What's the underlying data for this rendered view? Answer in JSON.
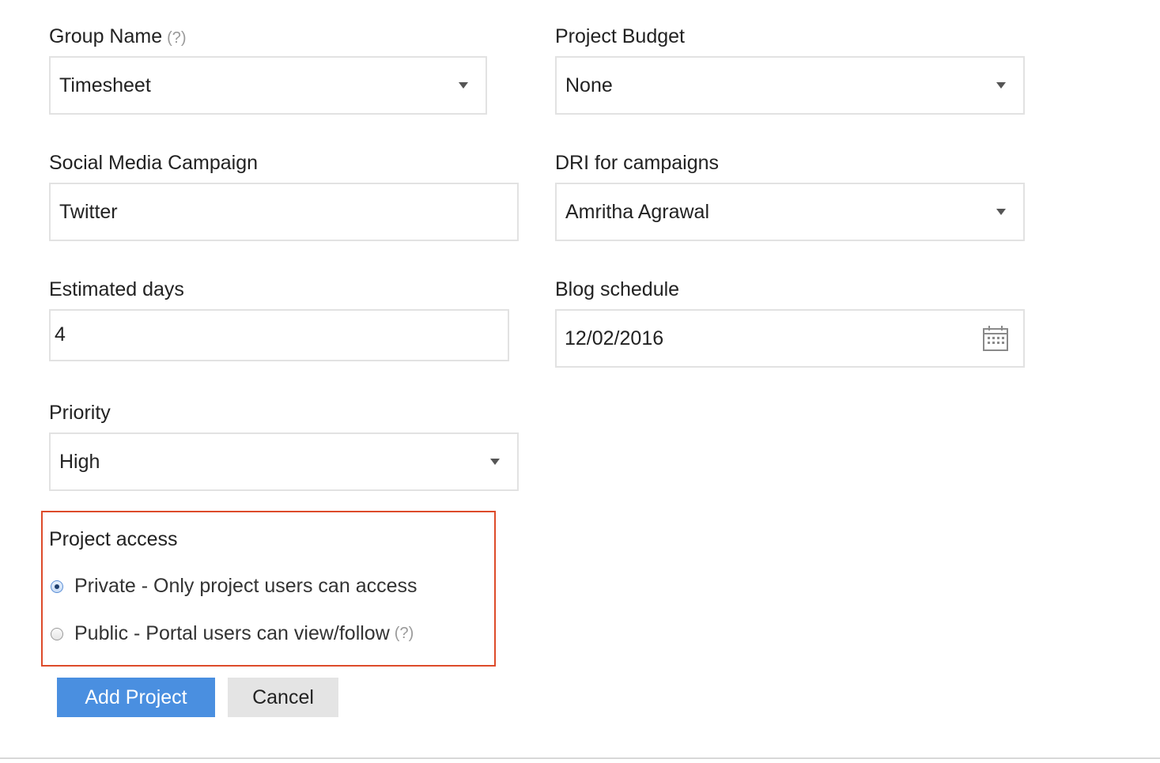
{
  "form": {
    "group_name": {
      "label": "Group Name",
      "help": "(?)",
      "value": "Timesheet"
    },
    "project_budget": {
      "label": "Project Budget",
      "value": "None"
    },
    "social_media_campaign": {
      "label": "Social Media Campaign",
      "value": "Twitter"
    },
    "dri_for_campaigns": {
      "label": "DRI for campaigns",
      "value": "Amritha Agrawal"
    },
    "estimated_days": {
      "label": "Estimated days",
      "value": "4"
    },
    "blog_schedule": {
      "label": "Blog schedule",
      "value": "12/02/2016"
    },
    "priority": {
      "label": "Priority",
      "value": "High"
    }
  },
  "project_access": {
    "label": "Project access",
    "options": [
      {
        "label": "Private - Only project users can access",
        "checked": true
      },
      {
        "label": "Public - Portal users can view/follow",
        "help": "(?)",
        "checked": false
      }
    ]
  },
  "actions": {
    "add_project": "Add Project",
    "cancel": "Cancel"
  },
  "colors": {
    "primary_button": "#4a8fe0",
    "access_border": "#dd4b2a",
    "field_border": "#e2e2e2"
  },
  "icons": {
    "dropdown": "caret-down-icon",
    "calendar": "calendar-icon"
  }
}
